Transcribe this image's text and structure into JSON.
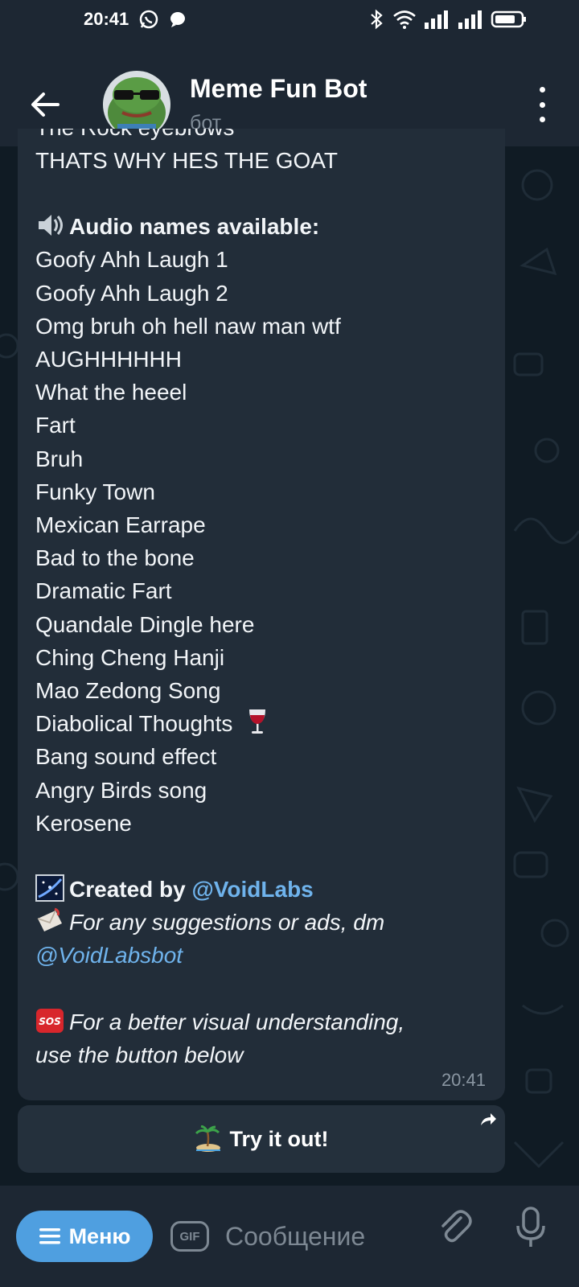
{
  "status_bar": {
    "time": "20:41"
  },
  "header": {
    "title": "Meme Fun Bot",
    "subtitle": "бот"
  },
  "message": {
    "partial_top_line": "The Rock eyebrows",
    "line_goat": "THATS WHY HES THE GOAT",
    "audio_heading": "Audio names available:",
    "audio_names": [
      "Goofy Ahh Laugh 1",
      "Goofy Ahh Laugh 2",
      "Omg bruh oh hell naw man wtf",
      "AUGHHHHHH",
      "What the heeel",
      "Fart",
      "Bruh",
      "Funky Town",
      "Mexican Earrape",
      "Bad to the bone",
      "Dramatic Fart",
      "Quandale Dingle here",
      "Ching Cheng Hanji",
      "Mao Zedong Song",
      "Diabolical Thoughts",
      "Bang sound effect",
      "Angry Birds song",
      "Kerosene"
    ],
    "created_by_label": "Created by",
    "created_by_link": "@VoidLabs",
    "suggestions_text": "For any suggestions or ads, dm",
    "suggestions_link": "@VoidLabsbot",
    "visual_line_1": "For a better visual understanding,",
    "visual_line_2": "use the button below",
    "time": "20:41"
  },
  "inline_button": {
    "label": "Try it out!"
  },
  "composer": {
    "menu_label": "Меню",
    "gif_label": "GIF",
    "placeholder": "Сообщение"
  },
  "colors": {
    "accent": "#4f9fe0",
    "link": "#6fb3ec",
    "bubble": "#222d39",
    "header": "#1d2733"
  },
  "icons": [
    "back-arrow-icon",
    "more-vert-icon",
    "speaker-icon",
    "galaxy-icon",
    "envelope-icon",
    "sos-icon",
    "wine-glass-icon",
    "island-icon",
    "share-icon",
    "menu-lines-icon",
    "gif-icon",
    "paperclip-icon",
    "microphone-icon",
    "whatsapp-icon",
    "chat-icon",
    "bluetooth-icon",
    "wifi-icon",
    "signal-icon",
    "battery-icon"
  ]
}
